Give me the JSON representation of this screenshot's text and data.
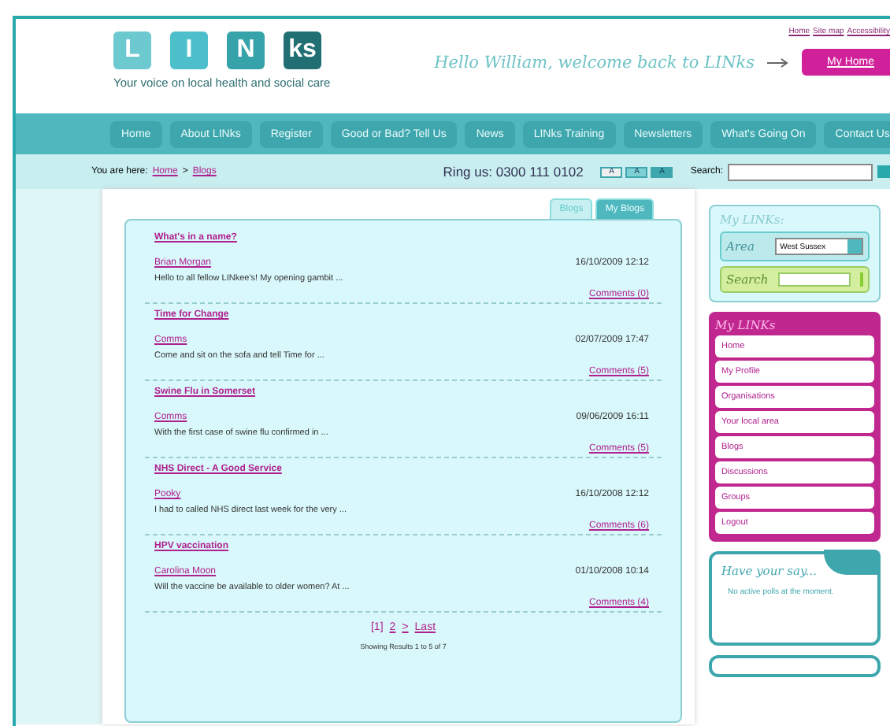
{
  "top_links": [
    "Home",
    "Site map",
    "Accessibility"
  ],
  "logo": {
    "letters": [
      "L",
      "I",
      "N",
      "ks"
    ],
    "tagline": "Your voice on local health and social care"
  },
  "welcome": "Hello William, welcome back to LINks",
  "my_home": "My Home",
  "nav": [
    "Home",
    "About LINks",
    "Register",
    "Good or Bad? Tell Us",
    "News",
    "LINks Training",
    "Newsletters",
    "What's Going On",
    "Contact Us"
  ],
  "breadcrumb": {
    "label": "You are here:",
    "items": [
      "Home",
      "Blogs"
    ],
    "separator": ">"
  },
  "ring_us": "Ring us: 0300 111 0102",
  "text_sizes": [
    "A",
    "A",
    "A"
  ],
  "search_label": "Search:",
  "tabs": [
    {
      "label": "Blogs",
      "selected": true
    },
    {
      "label": "My Blogs",
      "selected": false
    }
  ],
  "posts": [
    {
      "title": "What's in a name?",
      "author": "Brian Morgan",
      "date": "16/10/2009 12:12",
      "excerpt": "Hello to all fellow LINkee's! My opening gambit ...",
      "comments": "Comments (0)"
    },
    {
      "title": "Time for Change",
      "author": "Comms",
      "date": "02/07/2009 17:47",
      "excerpt": "Come and sit on the sofa and tell Time for ...",
      "comments": "Comments (5)"
    },
    {
      "title": "Swine Flu in Somerset",
      "author": "Comms",
      "date": "09/06/2009 16:11",
      "excerpt": "With the first case of swine flu confirmed in ...",
      "comments": "Comments (5)"
    },
    {
      "title": "NHS Direct - A Good Service",
      "author": "Pooky",
      "date": "16/10/2008 12:12",
      "excerpt": "I had to called NHS direct last week for the very ...",
      "comments": "Comments (6)"
    },
    {
      "title": "HPV vaccination",
      "author": "Carolina Moon",
      "date": "01/10/2008 10:14",
      "excerpt": "Will the vaccine be available to older women? At ...",
      "comments": "Comments (4)"
    }
  ],
  "pager": [
    {
      "label": "[1]",
      "selected": true
    },
    {
      "label": "2",
      "selected": false
    },
    {
      "label": ">",
      "selected": false
    },
    {
      "label": "Last",
      "selected": false
    }
  ],
  "results": "Showing Results 1 to 5 of 7",
  "my_links_box": {
    "title": "My LINKs:",
    "area_label": "Area",
    "area_value": "West Sussex",
    "search_label": "Search"
  },
  "menu": {
    "title": "My LINKs",
    "items": [
      "Home",
      "My Profile",
      "Organisations",
      "Your local area",
      "Blogs",
      "Discussions",
      "Groups",
      "Logout"
    ]
  },
  "have_your_say": {
    "title": "Have your say...",
    "text": "No active polls at the moment."
  }
}
